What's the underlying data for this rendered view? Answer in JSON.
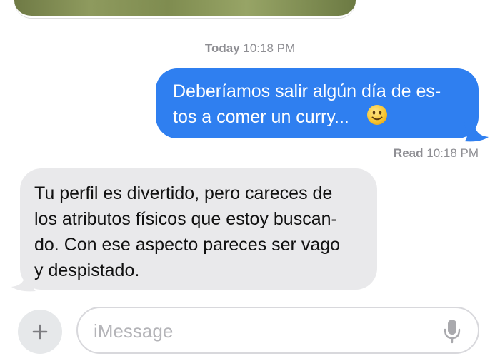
{
  "conversation": {
    "timestamp": {
      "day": "Today",
      "time": "10:18 PM"
    },
    "messages": [
      {
        "direction": "outgoing",
        "lines": [
          "Deberíamos salir algún día de es-",
          "tos a comer un curry..."
        ],
        "emoji": "slightly-smiling-face-emoji"
      },
      {
        "direction": "incoming",
        "lines": [
          "Tu perfil es divertido, pero careces de",
          "los atributos físicos que estoy buscan-",
          "do. Con ese aspecto pareces ser vago",
          "y despistado."
        ]
      }
    ],
    "read_receipt": {
      "status": "Read",
      "time": "10:18 PM"
    }
  },
  "input_bar": {
    "plus_icon": "plus-icon",
    "placeholder": "iMessage",
    "mic_icon": "microphone-icon"
  },
  "colors": {
    "outgoing_bubble": "#2f7ff0",
    "incoming_bubble": "#e9e9eb",
    "meta_text": "#8e8e93"
  }
}
